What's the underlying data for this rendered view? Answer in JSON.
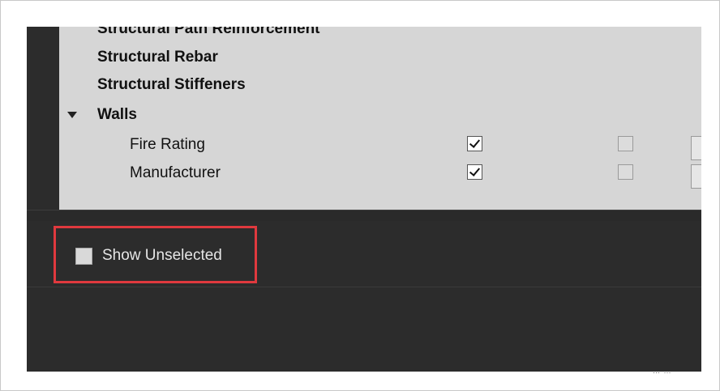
{
  "parameters_list": {
    "rows": [
      {
        "label": "Structural Path Reinforcement",
        "bold": true,
        "indent": 0
      },
      {
        "label": "Structural Rebar",
        "bold": true,
        "indent": 0
      },
      {
        "label": "Structural Stiffeners",
        "bold": true,
        "indent": 0
      },
      {
        "label": "Walls",
        "bold": true,
        "indent": 0,
        "expanded": true
      },
      {
        "label": "Fire Rating",
        "bold": false,
        "indent": 1,
        "col1_checked": true,
        "col2_checked": false
      },
      {
        "label": "Manufacturer",
        "bold": false,
        "indent": 1,
        "col1_checked": true,
        "col2_checked": false
      }
    ]
  },
  "footer": {
    "show_unselected_label": "Show Unselected",
    "show_unselected_checked": false
  },
  "colors": {
    "panel_bg": "#2c2c2c",
    "list_bg": "#d6d6d6",
    "highlight": "#e0393e"
  }
}
